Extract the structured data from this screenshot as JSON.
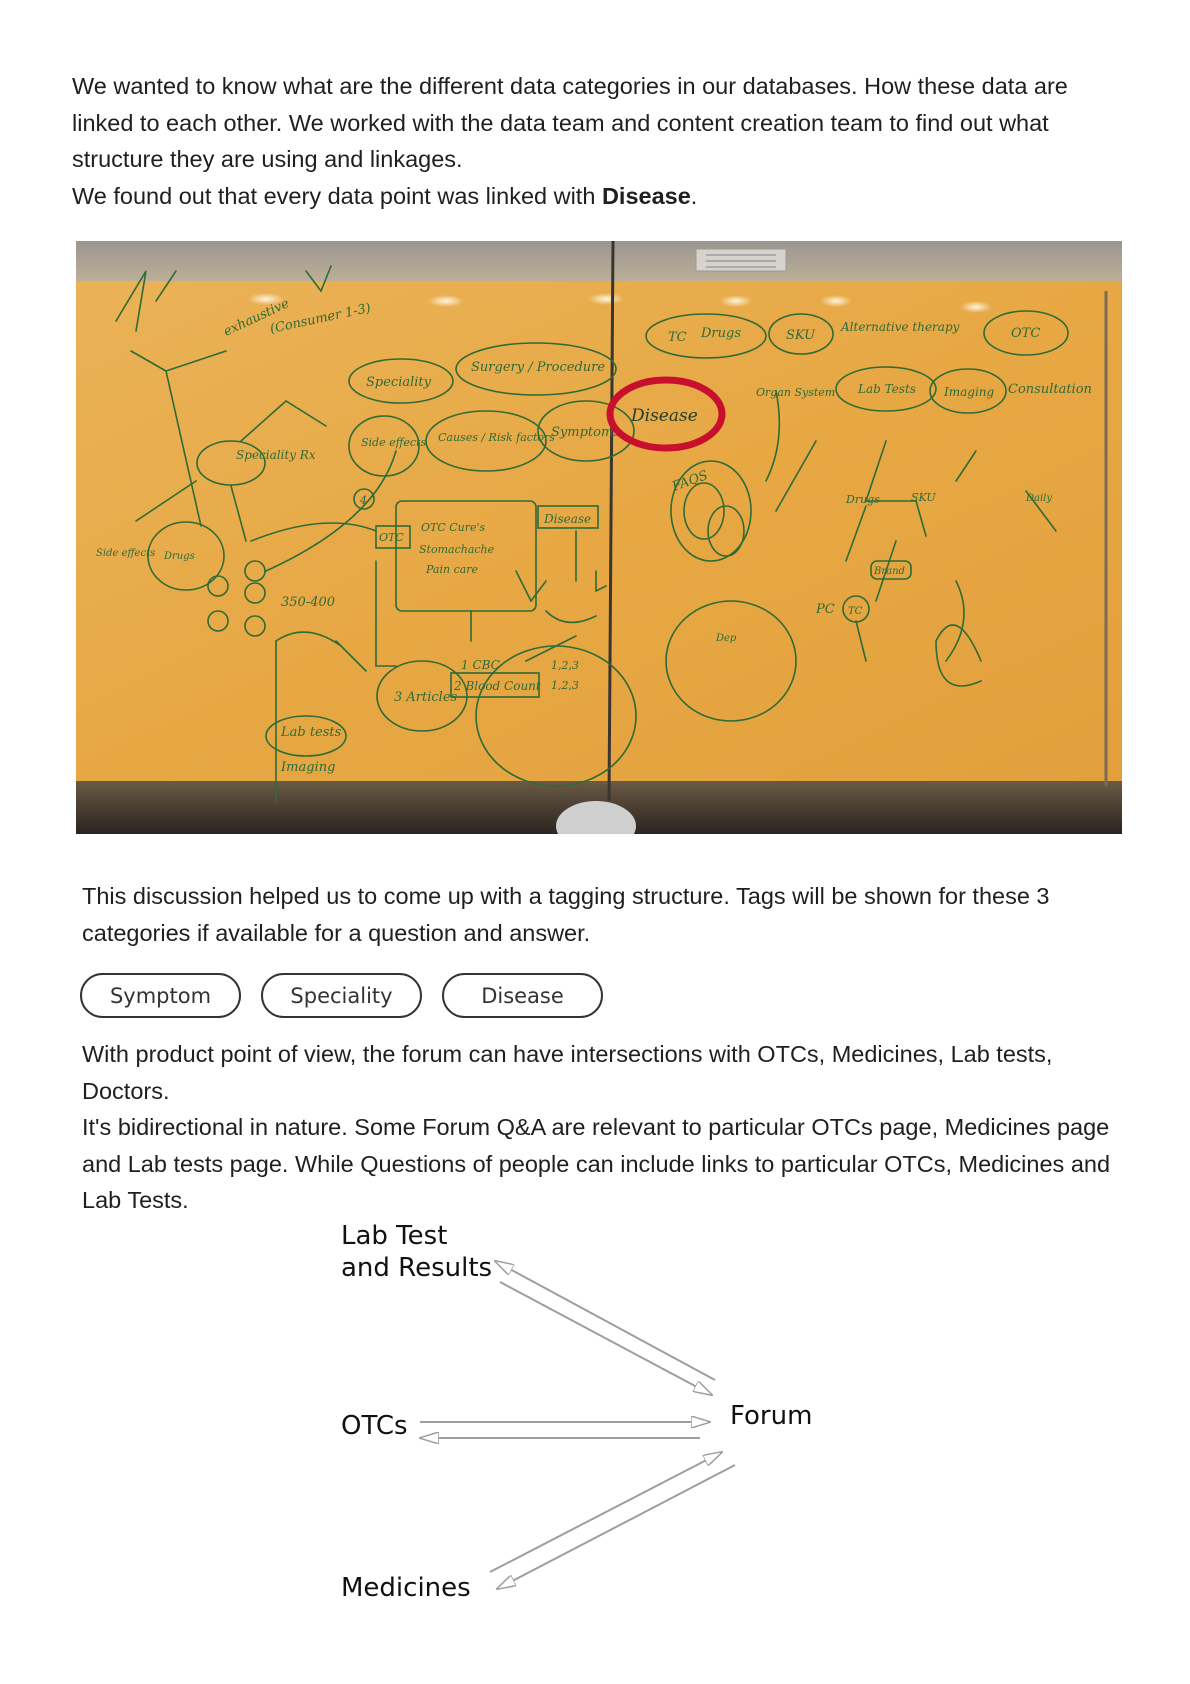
{
  "intro": {
    "line1": "We wanted to know what are the different data categories in our databases. How these data are linked to each other. We worked with the data team and content creation team to find out what structure they are using and linkages.",
    "line2_prefix": "We found out that every data point was linked with ",
    "line2_bold": "Disease",
    "line2_suffix": "."
  },
  "whiteboard": {
    "labels": {
      "exhaustive": "exhaustive",
      "consumer": "(Consumer 1-3)",
      "speciality": "Speciality",
      "surgery": "Surgery / Procedure",
      "side_effects": "Side effects",
      "causes": "Causes / Risk factors",
      "symptoms": "Symptoms",
      "disease_circled": "Disease",
      "organ_system": "Organ System",
      "lab_tests": "Lab Tests",
      "imaging": "Imaging",
      "consultation": "Consultation",
      "alternative": "Alternative therapy",
      "otc_top": "OTC",
      "tc": "TC",
      "drugs_top": "Drugs",
      "sku": "SKU",
      "speciality_rx": "Speciality Rx",
      "otc_cure": "OTC Cure's",
      "stomachache": "Stomachache",
      "pain_care": "Pain care",
      "otc_box": "OTC",
      "disease_mid": "Disease",
      "cbc": "1 CBC",
      "blood_count": "2 Blood Count",
      "articles": "3 Articles",
      "lab_tests_left": "Lab tests",
      "imaging_left": "Imaging",
      "range": "350-400",
      "drugs_left": "Drugs",
      "side_effects_left": "Side effects",
      "faqs": "FAQS",
      "drugs_right": "Drugs",
      "sku_right": "SKU",
      "brand": "Brand",
      "pc": "PC",
      "tc_right": "TC",
      "dep": "Dep",
      "daily": "Daily",
      "num_4": "4",
      "num_123a": "1,2,3",
      "num_123b": "1,2,3"
    }
  },
  "tagging": {
    "text": "This discussion helped us to come up with a tagging structure. Tags will be shown for these 3 categories if available for a question and answer.",
    "tags": [
      "Symptom",
      "Speciality",
      "Disease"
    ]
  },
  "product": {
    "line1": "With product point of view, the forum can have intersections with OTCs, Medicines, Lab tests, Doctors.",
    "line2": "It's bidirectional in nature. Some Forum Q&A are relevant to particular OTCs page, Medicines page and Lab tests page. While Questions of people can include links to particular OTCs, Medicines and Lab Tests."
  },
  "flow": {
    "nodes": {
      "lab_test": "Lab Test\nand Results",
      "otcs": "OTCs",
      "forum": "Forum",
      "medicines": "Medicines"
    },
    "arrow_color": "#9e9e9e"
  },
  "colors": {
    "board": "#e8a845",
    "marker": "#2e6b37",
    "highlight_circle": "#c8102e"
  }
}
